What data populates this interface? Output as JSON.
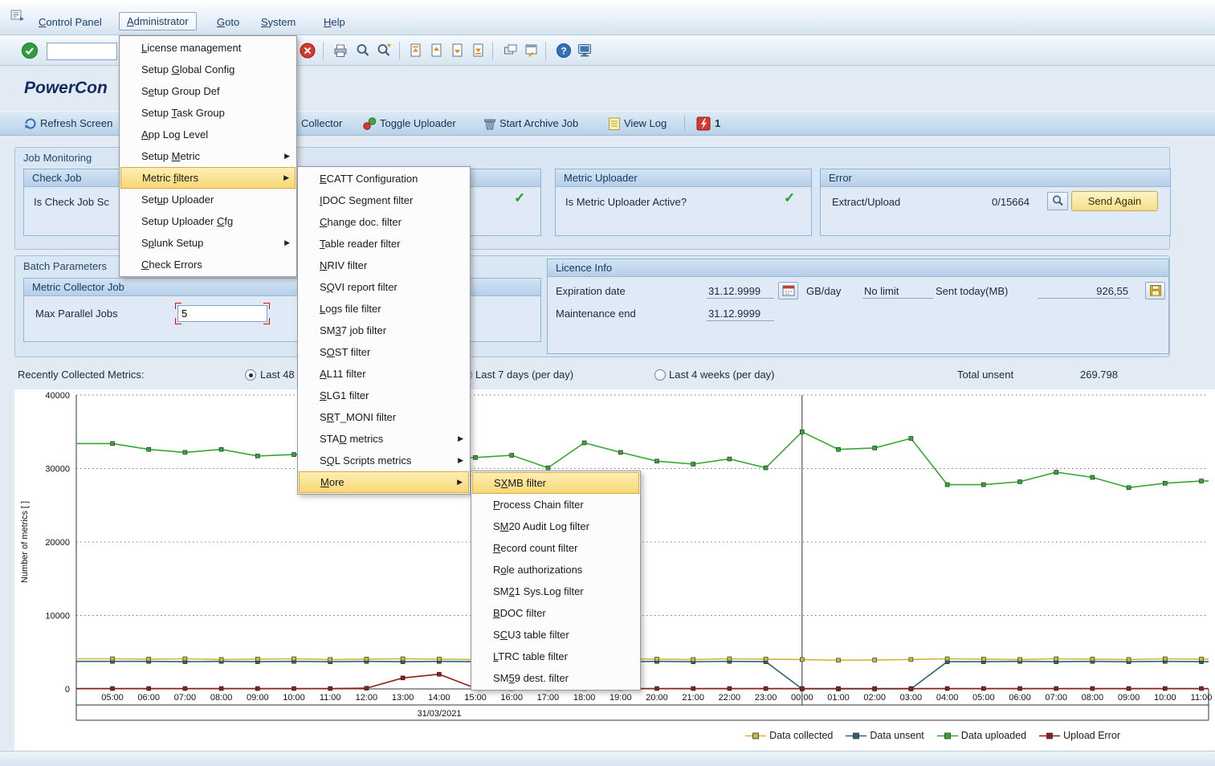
{
  "title": "PowerCon",
  "colors": {
    "menu_highlight": "#f8d876",
    "panel_header": "#c4d9ef",
    "success_check": "#1e9e28",
    "send_again_button": "#f3df8d"
  },
  "menubar": {
    "items": [
      {
        "label": "Control Panel",
        "accel": 0
      },
      {
        "label": "Administrator",
        "accel": 0,
        "active": true
      },
      {
        "label": "Goto",
        "accel": 0
      },
      {
        "label": "System",
        "accel": 0
      },
      {
        "label": "Help",
        "accel": 0
      }
    ]
  },
  "toolbar": {
    "command_value": "",
    "icons": [
      "continue-icon",
      "cancel-icon",
      "print-icon",
      "find-icon",
      "find-next-icon",
      "first-page-icon",
      "previous-page-icon",
      "next-page-icon",
      "last-page-icon",
      "new-session-icon",
      "create-shortcut-icon",
      "help-icon",
      "layout-monitor-icon"
    ]
  },
  "app_toolbar": {
    "refresh": "Refresh Screen",
    "collector_fragment": "Collector",
    "toggle_uploader": "Toggle Uploader",
    "start_archive": "Start Archive Job",
    "view_log": "View Log",
    "flag_count": "1",
    "icons": [
      "refresh-icon",
      "toggle-uploader-icon",
      "archive-icon",
      "view-log-icon",
      "error-flag-icon"
    ]
  },
  "job_monitoring": {
    "title": "Job Monitoring",
    "check_job": {
      "title": "Check Job",
      "question": "Is Check Job Sc"
    },
    "metric_uploader": {
      "title": "Metric Uploader",
      "question": "Is Metric Uploader Active?"
    },
    "error": {
      "title": "Error",
      "label": "Extract/Upload",
      "value": "0/15664",
      "send_again": "Send Again"
    }
  },
  "batch_parameters": {
    "title": "Batch Parameters",
    "metric_collector_job": {
      "title": "Metric Collector Job",
      "max_parallel_label": "Max Parallel Jobs",
      "max_parallel_value": "5"
    },
    "licence_info": {
      "title": "Licence Info",
      "expiration_label": "Expiration date",
      "expiration_value": "31.12.9999",
      "gbday_label": "GB/day",
      "gbday_value": "No limit",
      "sent_today_label": "Sent today(MB)",
      "sent_today_value": "926,55",
      "maintenance_label": "Maintenance end",
      "maintenance_value": "31.12.9999"
    }
  },
  "metrics_bar": {
    "label": "Recently Collected Metrics:",
    "options": [
      {
        "label": "Last 48",
        "selected": true
      },
      {
        "label": "Last 7 days (per day)",
        "selected": false
      },
      {
        "label": "Last 4 weeks (per day)",
        "selected": false
      }
    ],
    "total_unsent_label": "Total unsent",
    "total_unsent_value": "269.798"
  },
  "menus": {
    "administrator": {
      "items": [
        {
          "label": "License management",
          "accel": 0
        },
        {
          "label": "Setup Global Config",
          "accel": 6
        },
        {
          "label": "Setup Group Def",
          "accel": 1
        },
        {
          "label": "Setup Task Group",
          "accel": 6
        },
        {
          "label": "App Log Level",
          "accel": 0
        },
        {
          "label": "Setup Metric",
          "accel": 6,
          "submenu": true
        },
        {
          "label": "Metric filters",
          "accel": 7,
          "submenu": true,
          "highlight": true
        },
        {
          "label": "Setup Uploader",
          "accel": 3
        },
        {
          "label": "Setup Uploader Cfg",
          "accel": 15
        },
        {
          "label": "Splunk Setup",
          "accel": 1,
          "submenu": true
        },
        {
          "label": "Check Errors",
          "accel": 0
        }
      ]
    },
    "metric_filters": {
      "items": [
        {
          "label": "ECATT Configuration",
          "accel": 0
        },
        {
          "label": "IDOC Segment filter",
          "accel": 0
        },
        {
          "label": "Change doc. filter",
          "accel": 0
        },
        {
          "label": "Table reader filter",
          "accel": 0
        },
        {
          "label": "NRIV filter",
          "accel": 0
        },
        {
          "label": "SQVI report filter",
          "accel": 1
        },
        {
          "label": "Logs file filter",
          "accel": 0
        },
        {
          "label": "SM37 job filter",
          "accel": 2
        },
        {
          "label": "SOST filter",
          "accel": 1
        },
        {
          "label": "AL11 filter",
          "accel": 0
        },
        {
          "label": "SLG1 filter",
          "accel": 0
        },
        {
          "label": "SRT_MONI filter",
          "accel": 1
        },
        {
          "label": "STAD metrics",
          "accel": 3,
          "submenu": true
        },
        {
          "label": "SQL Scripts metrics",
          "accel": 1,
          "submenu": true
        },
        {
          "label": "More",
          "accel": 0,
          "submenu": true,
          "highlight": true
        }
      ]
    },
    "more": {
      "items": [
        {
          "label": "SXMB filter",
          "accel": 1,
          "highlight": true
        },
        {
          "label": "Process Chain filter",
          "accel": 0
        },
        {
          "label": "SM20 Audit Log filter",
          "accel": 1
        },
        {
          "label": "Record count filter",
          "accel": 0
        },
        {
          "label": "Role authorizations",
          "accel": 1
        },
        {
          "label": "SM21 Sys.Log filter",
          "accel": 2
        },
        {
          "label": "BDOC filter",
          "accel": 0
        },
        {
          "label": "SCU3 table filter",
          "accel": 1
        },
        {
          "label": "LTRC table filter",
          "accel": 0
        },
        {
          "label": "SM59 dest. filter",
          "accel": 2
        }
      ]
    }
  },
  "chart_data": {
    "type": "line",
    "title": "",
    "ylabel": "Number of metrics [ ]",
    "ylim": [
      0,
      40000
    ],
    "yticks": [
      0,
      10000,
      20000,
      30000,
      40000
    ],
    "grid": "horizontal-dotted",
    "legend_position": "bottom-right",
    "date_label": "31/03/2021",
    "day_boundary_index": 19,
    "x": [
      "05:00",
      "06:00",
      "07:00",
      "08:00",
      "09:00",
      "10:00",
      "11:00",
      "12:00",
      "13:00",
      "14:00",
      "15:00",
      "16:00",
      "17:00",
      "18:00",
      "19:00",
      "20:00",
      "21:00",
      "22:00",
      "23:00",
      "00:00",
      "01:00",
      "02:00",
      "03:00",
      "04:00",
      "05:00",
      "06:00",
      "07:00",
      "08:00",
      "09:00",
      "10:00",
      "11:00"
    ],
    "series": [
      {
        "name": "Data collected",
        "color": "#c9b83a",
        "values": [
          4100,
          4050,
          4100,
          4000,
          4050,
          4100,
          4000,
          4050,
          4100,
          4050,
          4000,
          4100,
          4050,
          4000,
          4100,
          4050,
          4000,
          4100,
          4050,
          4000,
          3900,
          3950,
          4000,
          4100,
          4050,
          4000,
          4100,
          4050,
          4000,
          4100,
          4050
        ]
      },
      {
        "name": "Data unsent",
        "color": "#2b6577",
        "values": [
          3750,
          3750,
          3700,
          3750,
          3700,
          3750,
          3700,
          3750,
          3700,
          3750,
          3700,
          3750,
          3700,
          3750,
          3700,
          3750,
          3700,
          3750,
          3700,
          0,
          0,
          0,
          0,
          3700,
          3700,
          3750,
          3700,
          3750,
          3700,
          3750,
          3700
        ]
      },
      {
        "name": "Data uploaded",
        "color": "#35a733",
        "values": [
          33400,
          32600,
          32200,
          32600,
          31700,
          31900,
          31800,
          31600,
          31400,
          31300,
          31500,
          31800,
          30100,
          33500,
          32200,
          31000,
          30600,
          31300,
          30100,
          35000,
          32600,
          32800,
          34100,
          27800,
          27800,
          28200,
          29500,
          28800,
          27400,
          28000,
          28300
        ]
      },
      {
        "name": "Upload Error",
        "color": "#8e1f15",
        "values": [
          50,
          50,
          50,
          50,
          50,
          50,
          50,
          100,
          1500,
          2000,
          100,
          50,
          50,
          50,
          50,
          50,
          50,
          50,
          50,
          50,
          50,
          50,
          50,
          50,
          50,
          50,
          50,
          50,
          50,
          50,
          50
        ]
      }
    ]
  }
}
